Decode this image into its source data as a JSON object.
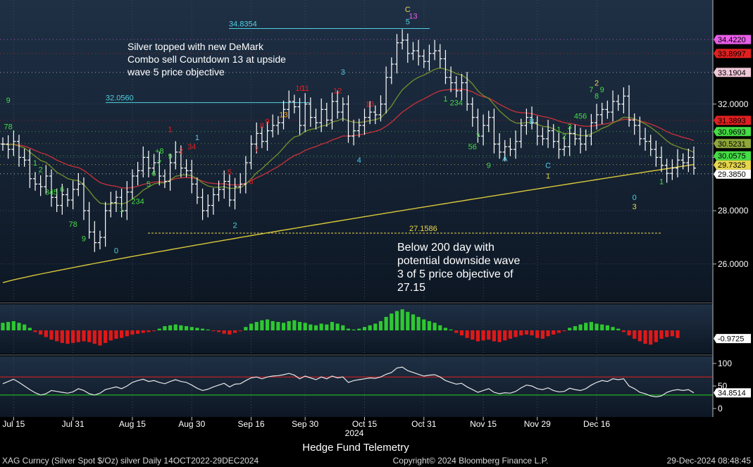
{
  "chart_data": {
    "type": "candlestick",
    "title": "Hedge Fund Telemetry",
    "footer_left": "XAG Curncy (Silver Spot  $/Oz) silver  Daily 14OCT2022-29DEC2024",
    "footer_center": "Copyright© 2024 Bloomberg Finance L.P.",
    "footer_right": "29-Dec-2024 08:48:45",
    "year_label": "2024",
    "x_tick_labels": [
      "Jul 15",
      "Jul 31",
      "Aug 15",
      "Aug 30",
      "Sep 16",
      "Sep 30",
      "Oct 15",
      "Oct 31",
      "Nov 15",
      "Nov 29",
      "Dec 16"
    ],
    "price_ticks": [
      "32.0000",
      "30.0000",
      "28.0000",
      "26.0000"
    ],
    "price_ylim": [
      24.7,
      35.8
    ],
    "close": [
      30.5,
      30.3,
      30.6,
      30.0,
      29.9,
      29.2,
      29.0,
      28.9,
      29.3,
      28.5,
      28.2,
      28.6,
      28.4,
      28.8,
      29.0,
      28.0,
      27.2,
      26.8,
      27.0,
      28.0,
      28.3,
      28.5,
      28.0,
      28.7,
      29.3,
      29.5,
      30.0,
      29.6,
      29.8,
      29.3,
      29.1,
      29.8,
      30.2,
      29.6,
      29.5,
      29.0,
      28.5,
      28.0,
      28.2,
      28.6,
      28.8,
      29.1,
      28.4,
      28.9,
      29.0,
      29.8,
      30.5,
      30.9,
      30.6,
      31.0,
      31.2,
      31.3,
      31.8,
      32.1,
      31.9,
      31.2,
      32.0,
      31.5,
      31.3,
      31.8,
      31.4,
      32.1,
      31.7,
      32.0,
      30.8,
      31.0,
      31.2,
      31.5,
      31.7,
      31.6,
      32.0,
      33.0,
      33.5,
      34.3,
      34.4,
      33.9,
      34.0,
      33.8,
      33.6,
      33.9,
      34.0,
      33.7,
      33.0,
      32.8,
      32.5,
      32.8,
      32.0,
      31.5,
      30.8,
      31.2,
      31.5,
      30.5,
      30.2,
      30.4,
      30.3,
      30.6,
      31.2,
      31.5,
      31.3,
      30.8,
      30.7,
      31.0,
      30.6,
      30.3,
      30.4,
      30.9,
      30.7,
      30.5,
      30.8,
      31.3,
      31.6,
      31.8,
      31.7,
      32.1,
      32.0,
      32.3,
      31.4,
      31.2,
      30.7,
      30.6,
      30.3,
      30.0,
      29.7,
      29.4,
      29.6,
      29.9,
      29.8,
      30.0,
      29.6
    ],
    "sma_200_level": "29.7325",
    "sma_50_level": "31.3893",
    "sma_20_level": "30.9693",
    "level_labels": [
      {
        "text": "34.4220",
        "color": "#e85ee8",
        "value": 34.422
      },
      {
        "text": "33.8997",
        "color": "#e02020",
        "value": 33.9
      },
      {
        "text": "33.1904",
        "color": "#f0c8d8",
        "value": 33.19
      },
      {
        "text": "31.3893",
        "color": "#e02020",
        "value": 31.39
      },
      {
        "text": "30.9693",
        "color": "#44dd44",
        "value": 30.97
      },
      {
        "text": "30.5231",
        "color": "#8fa63a",
        "value": 30.52
      },
      {
        "text": "30.0575",
        "color": "#44dd44",
        "value": 30.06
      },
      {
        "text": "29.7325",
        "color": "#e8d64a",
        "value": 29.73
      },
      {
        "text": "29.3850",
        "color": "#ffffff",
        "value": 29.385
      }
    ],
    "chart_labels": [
      {
        "text": "34.8354",
        "color": "#4fd0e0",
        "value": 34.8354
      },
      {
        "text": "32.0560",
        "color": "#4fd0e0",
        "value": 32.056
      },
      {
        "text": "27.1586",
        "color": "#e8d64a",
        "value": 27.1586
      }
    ],
    "annotations": {
      "top": [
        "Silver topped with new DeMark",
        "Combo sell Countdown 13 at upside",
        "wave 5 price objective"
      ],
      "bottom": [
        "Below 200 day with",
        "potential downside wave",
        "3 of 5 price objective of",
        "27.15"
      ]
    },
    "demark_labels": [
      {
        "text": "9",
        "i": 1,
        "value": 32.05,
        "color": "#44dd44",
        "size": 16
      },
      {
        "text": "78",
        "i": 1,
        "value": 31.05,
        "color": "#44dd44",
        "size": 11
      },
      {
        "text": "1",
        "i": 6,
        "value": 29.7,
        "color": "#44dd44",
        "size": 11
      },
      {
        "text": "2",
        "i": 7,
        "value": 29.45,
        "color": "#44dd44",
        "size": 11
      },
      {
        "text": "345",
        "i": 9,
        "value": 28.6,
        "color": "#44dd44",
        "size": 11
      },
      {
        "text": "6",
        "i": 11,
        "value": 28.7,
        "color": "#44dd44",
        "size": 11
      },
      {
        "text": "78",
        "i": 13,
        "value": 27.4,
        "color": "#44dd44",
        "size": 11
      },
      {
        "text": "9",
        "i": 15,
        "value": 26.85,
        "color": "#44dd44",
        "size": 16
      },
      {
        "text": "0",
        "i": 21,
        "value": 26.4,
        "color": "#4fd0e0",
        "size": 11
      },
      {
        "text": "1",
        "i": 22,
        "value": 27.95,
        "color": "#44dd44",
        "size": 11
      },
      {
        "text": "234",
        "i": 25,
        "value": 28.25,
        "color": "#44dd44",
        "size": 11
      },
      {
        "text": "5",
        "i": 27,
        "value": 28.9,
        "color": "#44dd44",
        "size": 11
      },
      {
        "text": "6",
        "i": 28,
        "value": 29.3,
        "color": "#44dd44",
        "size": 11
      },
      {
        "text": "7",
        "i": 29,
        "value": 29.7,
        "color": "#44dd44",
        "size": 11
      },
      {
        "text": "+8",
        "i": 29,
        "value": 30.15,
        "color": "#44dd44",
        "size": 11
      },
      {
        "text": "9",
        "i": 31,
        "value": 29.95,
        "color": "#44dd44",
        "size": 16
      },
      {
        "text": "1",
        "i": 31,
        "value": 30.95,
        "color": "#e02020",
        "size": 11
      },
      {
        "text": "2",
        "i": 33,
        "value": 30.15,
        "color": "#e02020",
        "size": 11
      },
      {
        "text": "34",
        "i": 35,
        "value": 30.3,
        "color": "#e02020",
        "size": 11
      },
      {
        "text": "1",
        "i": 36,
        "value": 30.65,
        "color": "#4fd0e0",
        "size": 11
      },
      {
        "text": "5",
        "i": 42,
        "value": 29.35,
        "color": "#e02020",
        "size": 11
      },
      {
        "text": "6",
        "i": 46,
        "value": 29.0,
        "color": "#e02020",
        "size": 11
      },
      {
        "text": "7",
        "i": 47,
        "value": 30.2,
        "color": "#e02020",
        "size": 11
      },
      {
        "text": "2",
        "i": 43,
        "value": 27.35,
        "color": "#4fd0e0",
        "size": 11
      },
      {
        "text": "8",
        "i": 48,
        "value": 31.1,
        "color": "#e02020",
        "size": 11
      },
      {
        "text": "9",
        "i": 49,
        "value": 31.25,
        "color": "#e02020",
        "size": 11
      },
      {
        "text": "13",
        "i": 52,
        "value": 31.5,
        "color": "#f0a020",
        "size": 18
      },
      {
        "text": "10",
        "i": 55,
        "value": 32.5,
        "color": "#e02020",
        "size": 11
      },
      {
        "text": "11",
        "i": 56,
        "value": 32.5,
        "color": "#e02020",
        "size": 11
      },
      {
        "text": "3",
        "i": 63,
        "value": 33.1,
        "color": "#4fd0e0",
        "size": 11
      },
      {
        "text": "12",
        "i": 62,
        "value": 32.4,
        "color": "#e02020",
        "size": 11
      },
      {
        "text": "4",
        "i": 66,
        "value": 29.8,
        "color": "#4fd0e0",
        "size": 11
      },
      {
        "text": "13",
        "i": 68,
        "value": 31.9,
        "color": "#e02020",
        "size": 17
      },
      {
        "text": "C",
        "i": 75,
        "value": 35.45,
        "color": "#e8d64a",
        "size": 11
      },
      {
        "text": "5",
        "i": 75,
        "value": 35.0,
        "color": "#4fd0e0",
        "size": 11
      },
      {
        "text": "13",
        "i": 76,
        "value": 35.2,
        "color": "#e85ee8",
        "size": 18
      },
      {
        "text": "1",
        "i": 82,
        "value": 32.1,
        "color": "#44dd44",
        "size": 11
      },
      {
        "text": "234",
        "i": 84,
        "value": 31.95,
        "color": "#44dd44",
        "size": 11
      },
      {
        "text": "7",
        "i": 88,
        "value": 30.7,
        "color": "#44dd44",
        "size": 11
      },
      {
        "text": "56",
        "i": 87,
        "value": 30.3,
        "color": "#44dd44",
        "size": 11
      },
      {
        "text": "9",
        "i": 90,
        "value": 29.6,
        "color": "#44dd44",
        "size": 16
      },
      {
        "text": "A",
        "i": 93,
        "value": 29.85,
        "color": "#4fd0e0",
        "size": 11
      },
      {
        "text": "B",
        "i": 98,
        "value": 31.25,
        "color": "#4fd0e0",
        "size": 11
      },
      {
        "text": "C",
        "i": 101,
        "value": 29.6,
        "color": "#4fd0e0",
        "size": 11
      },
      {
        "text": "1",
        "i": 101,
        "value": 29.2,
        "color": "#e8d64a",
        "size": 11
      },
      {
        "text": "1",
        "i": 103,
        "value": 30.95,
        "color": "#44dd44",
        "size": 11
      },
      {
        "text": "2",
        "i": 104,
        "value": 30.7,
        "color": "#44dd44",
        "size": 11
      },
      {
        "text": "3",
        "i": 105,
        "value": 31.05,
        "color": "#44dd44",
        "size": 11
      },
      {
        "text": "456",
        "i": 107,
        "value": 31.45,
        "color": "#44dd44",
        "size": 11
      },
      {
        "text": "7",
        "i": 109,
        "value": 32.45,
        "color": "#44dd44",
        "size": 11
      },
      {
        "text": "2",
        "i": 110,
        "value": 32.7,
        "color": "#e8d64a",
        "size": 11
      },
      {
        "text": "8",
        "i": 110,
        "value": 32.2,
        "color": "#44dd44",
        "size": 11
      },
      {
        "text": "9",
        "i": 111,
        "value": 32.45,
        "color": "#44dd44",
        "size": 16
      },
      {
        "text": "0",
        "i": 117,
        "value": 28.4,
        "color": "#4fd0e0",
        "size": 11
      },
      {
        "text": "3",
        "i": 117,
        "value": 28.05,
        "color": "#e8d64a",
        "size": 11
      },
      {
        "text": "1",
        "i": 122,
        "value": 29.0,
        "color": "#44dd44",
        "size": 11
      }
    ],
    "oscillator_tick": "-0.9725",
    "oscillator_values": [
      0.9,
      1.0,
      1.1,
      0.9,
      0.7,
      0.3,
      -0.2,
      -0.5,
      -0.8,
      -1.1,
      -1.3,
      -1.5,
      -1.6,
      -1.5,
      -1.4,
      -1.3,
      -1.4,
      -1.6,
      -1.8,
      -1.5,
      -1.2,
      -1.0,
      -0.9,
      -0.7,
      -0.5,
      -0.4,
      -0.3,
      -0.2,
      -0.1,
      0.2,
      0.5,
      0.6,
      0.7,
      0.6,
      0.5,
      0.4,
      0.3,
      0.2,
      0.1,
      -0.1,
      -0.2,
      -0.4,
      -0.5,
      -0.3,
      -0.1,
      0.4,
      0.8,
      1.0,
      1.2,
      1.3,
      1.1,
      1.0,
      0.9,
      1.1,
      1.2,
      1.0,
      0.9,
      0.7,
      0.6,
      0.8,
      0.7,
      1.0,
      0.8,
      0.6,
      0.2,
      0.1,
      0.2,
      0.4,
      0.6,
      0.8,
      1.1,
      1.6,
      2.0,
      2.3,
      2.5,
      2.2,
      1.9,
      1.6,
      1.3,
      1.1,
      0.9,
      0.6,
      0.3,
      0.1,
      -0.3,
      -0.6,
      -0.9,
      -1.1,
      -1.3,
      -1.2,
      -1.1,
      -1.3,
      -1.4,
      -1.2,
      -1.0,
      -0.8,
      -0.6,
      -0.5,
      -0.6,
      -0.9,
      -1.0,
      -0.7,
      -0.5,
      -0.3,
      -0.1,
      0.3,
      0.5,
      0.7,
      0.9,
      1.0,
      0.8,
      0.7,
      0.6,
      0.4,
      0.2,
      -0.2,
      -0.6,
      -1.0,
      -1.3,
      -1.6,
      -1.7,
      -1.4,
      -1.0,
      -0.8,
      -0.7,
      -0.9
    ],
    "stoch_ticks": [
      "100",
      "50",
      "0"
    ],
    "stoch_level": "34.8514",
    "stoch_upper_line": 70,
    "stoch_lower_line": 30,
    "stoch_values": [
      55,
      60,
      65,
      58,
      50,
      42,
      35,
      30,
      33,
      40,
      38,
      36,
      34,
      37,
      44,
      40,
      33,
      30,
      34,
      42,
      45,
      48,
      44,
      50,
      58,
      62,
      65,
      60,
      62,
      58,
      55,
      60,
      64,
      60,
      58,
      52,
      45,
      40,
      43,
      48,
      52,
      56,
      48,
      54,
      55,
      62,
      68,
      70,
      66,
      70,
      72,
      73,
      75,
      78,
      74,
      66,
      72,
      68,
      64,
      70,
      66,
      72,
      68,
      70,
      58,
      62,
      64,
      66,
      68,
      67,
      70,
      76,
      80,
      90,
      92,
      84,
      80,
      76,
      72,
      74,
      75,
      70,
      62,
      58,
      54,
      56,
      48,
      42,
      36,
      40,
      44,
      36,
      33,
      35,
      34,
      38,
      46,
      52,
      50,
      44,
      42,
      46,
      40,
      37,
      38,
      45,
      42,
      40,
      44,
      52,
      58,
      62,
      60,
      66,
      64,
      66,
      50,
      44,
      36,
      33,
      28,
      26,
      28,
      36,
      40,
      42,
      40,
      42,
      34.85
    ]
  }
}
